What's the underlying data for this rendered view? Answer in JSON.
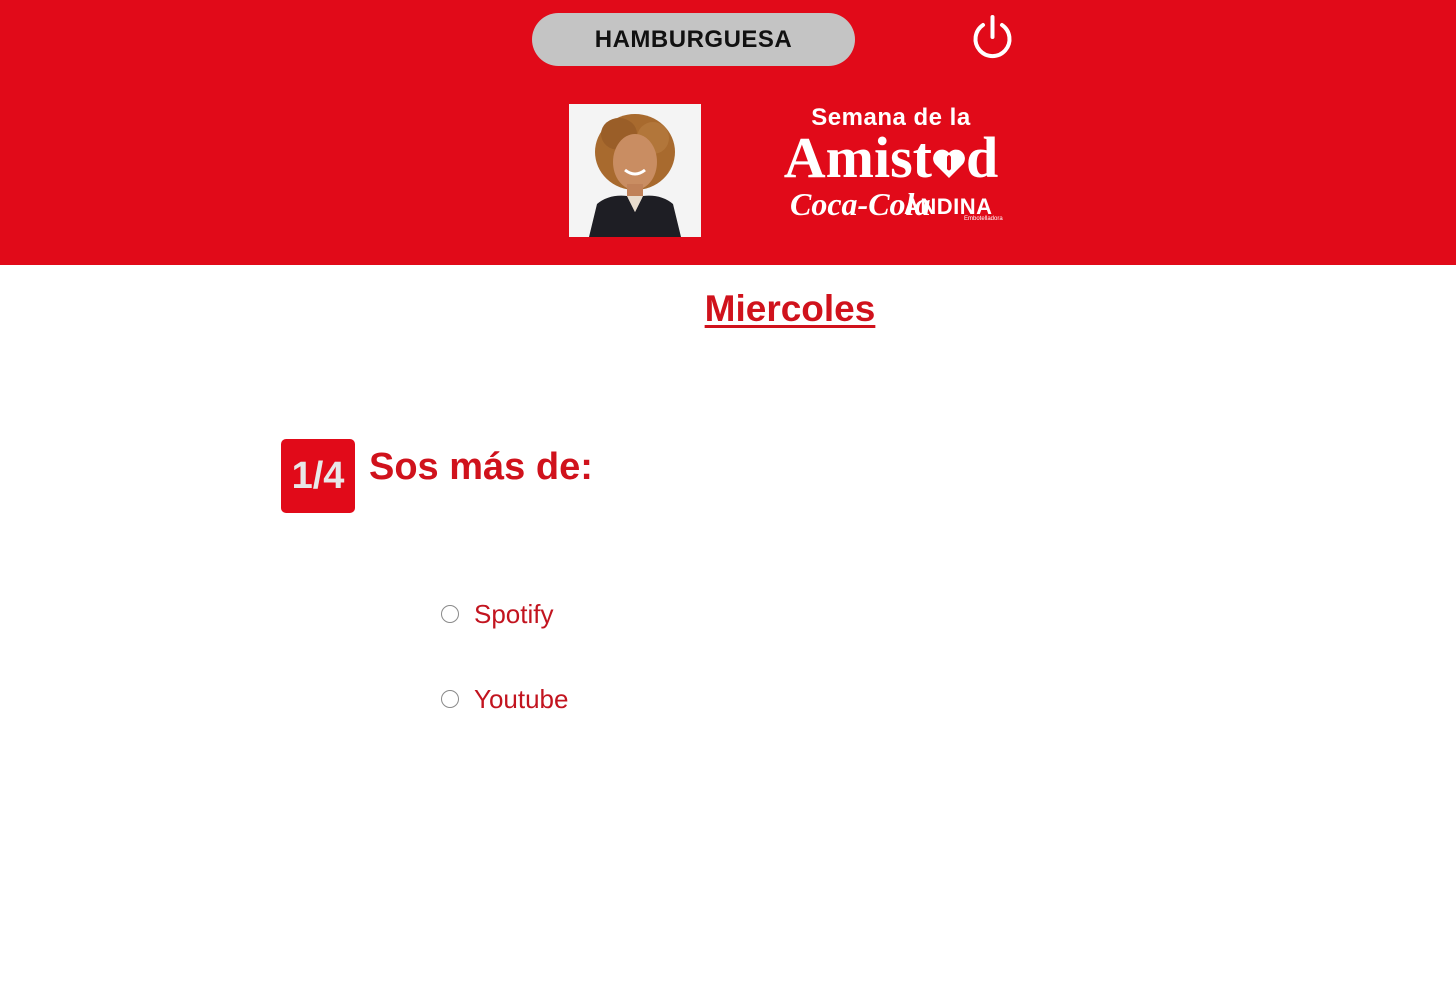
{
  "header": {
    "user_name": "HAMBURGUESA",
    "background_color": "#e10a19",
    "power_icon": "power-icon",
    "logo": {
      "line1": "Semana de la",
      "line2_a": "Amist",
      "line2_b": "d",
      "brand": "Coca-Cola",
      "partner": "ANDINA",
      "partner_sub": "Embotelladora"
    }
  },
  "main": {
    "day_title": "Miercoles",
    "question": {
      "number": "1/4",
      "text": "Sos más de:",
      "options": [
        {
          "label": "Spotify",
          "selected": false
        },
        {
          "label": "Youtube",
          "selected": false
        }
      ]
    },
    "accent_color": "#d0121c"
  }
}
